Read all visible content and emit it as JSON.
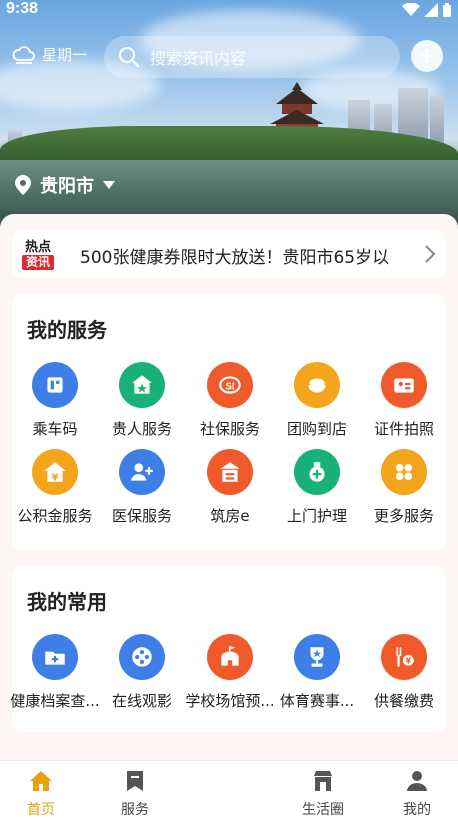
{
  "status": {
    "time": "9:38"
  },
  "top": {
    "weekday": "星期一",
    "search_placeholder": "搜索资讯内容",
    "city": "贵阳市"
  },
  "news": {
    "badge_top": "热点",
    "badge_bottom": "资讯",
    "text": "500张健康券限时大放送！贵阳市65岁以"
  },
  "services": {
    "title": "我的服务",
    "items": [
      {
        "label": "乘车码",
        "icon": "bus-code-icon",
        "color": "#3d7fe6"
      },
      {
        "label": "贵人服务",
        "icon": "star-house-icon",
        "color": "#19b07a"
      },
      {
        "label": "社保服务",
        "icon": "social-security-icon",
        "color": "#f05a2a"
      },
      {
        "label": "团购到店",
        "icon": "rice-bowl-icon",
        "color": "#f3a51c"
      },
      {
        "label": "证件拍照",
        "icon": "id-card-icon",
        "color": "#f05a2a"
      },
      {
        "label": "公积金服务",
        "icon": "fund-house-icon",
        "color": "#f3a51c"
      },
      {
        "label": "医保服务",
        "icon": "medical-insurance-icon",
        "color": "#3d7fe6"
      },
      {
        "label": "筑房e",
        "icon": "building-icon",
        "color": "#f05a2a"
      },
      {
        "label": "上门护理",
        "icon": "care-bag-icon",
        "color": "#19b07a"
      },
      {
        "label": "更多服务",
        "icon": "grid-apps-icon",
        "color": "#f3a51c"
      }
    ]
  },
  "favorites": {
    "title": "我的常用",
    "items": [
      {
        "label": "健康档案查...",
        "icon": "health-folder-icon",
        "color": "#3d7fe6"
      },
      {
        "label": "在线观影",
        "icon": "film-reel-icon",
        "color": "#3d7fe6"
      },
      {
        "label": "学校场馆预...",
        "icon": "school-venue-icon",
        "color": "#f05a2a"
      },
      {
        "label": "体育赛事...",
        "icon": "trophy-icon",
        "color": "#3d7fe6"
      },
      {
        "label": "供餐缴费",
        "icon": "meal-payment-icon",
        "color": "#f05a2a"
      }
    ]
  },
  "nav": {
    "tabs": [
      {
        "label": "首页",
        "icon": "home-icon"
      },
      {
        "label": "服务",
        "icon": "bookmark-icon"
      },
      {
        "label": "生活圈",
        "icon": "shop-icon"
      },
      {
        "label": "我的",
        "icon": "user-icon"
      }
    ],
    "active_color": "#e8a20c"
  }
}
